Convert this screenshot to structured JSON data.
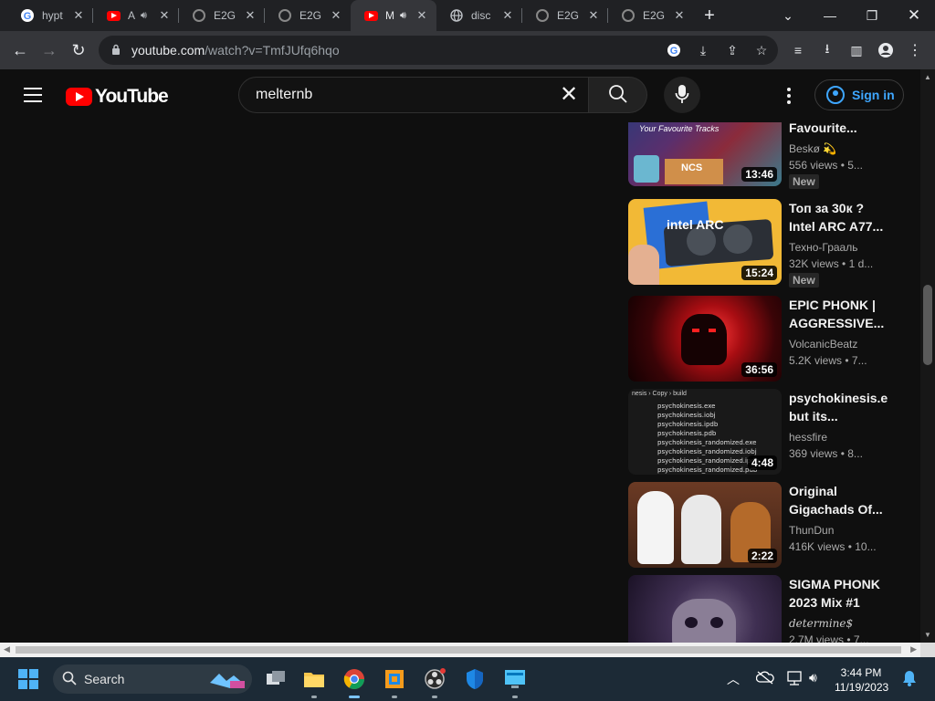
{
  "browser": {
    "tabs": [
      {
        "title": "hypt",
        "favicon": "google-icon",
        "active": false
      },
      {
        "title": "A",
        "favicon": "youtube-icon",
        "active": false,
        "audio": true
      },
      {
        "title": "E2G",
        "favicon": "github-icon",
        "active": false
      },
      {
        "title": "E2G",
        "favicon": "github-icon",
        "active": false
      },
      {
        "title": "M",
        "favicon": "youtube-icon",
        "active": true,
        "audio": true
      },
      {
        "title": "disc",
        "favicon": "globe-icon",
        "active": false
      },
      {
        "title": "E2G",
        "favicon": "github-icon",
        "active": false
      },
      {
        "title": "E2G",
        "favicon": "github-icon",
        "active": false
      }
    ],
    "url_host": "youtube.com",
    "url_path": "/watch?v=TmfJUfq6hqo"
  },
  "youtube": {
    "logo_text": "YouTube",
    "search_value": "melternb",
    "search_placeholder": "Search",
    "sign_in": "Sign in"
  },
  "videos": [
    {
      "title": "Favourite...",
      "thumb_text": "Your Favourite Tracks",
      "thumb_logo": "NCS",
      "channel": "Beskø 💫",
      "views": "556 views",
      "age": "5...",
      "duration": "13:46",
      "badge": "New"
    },
    {
      "title": "Топ за 30к ? Intel ARC A77...",
      "thumb_text": "intel ARC",
      "channel": "Техно-Грааль",
      "views": "32K views",
      "age": "1 d...",
      "duration": "15:24",
      "badge": "New"
    },
    {
      "title": "EPIC PHONK | AGGRESSIVE...",
      "channel": "VolcanicBeatz",
      "views": "5.2K views",
      "age": "7...",
      "duration": "36:56",
      "badge": ""
    },
    {
      "title": "psychokinesis.e but its...",
      "channel": "hessfire",
      "views": "369 views",
      "age": "8...",
      "duration": "4:48",
      "badge": "",
      "thumb_breadcrumb": "nesis › Copy › build",
      "thumb_files": [
        "psychokinesis.exe",
        "psychokinesis.iobj",
        "psychokinesis.ipdb",
        "psychokinesis.pdb",
        "psychokinesis_randomized.exe",
        "psychokinesis_randomized.iobj",
        "psychokinesis_randomized.ipdb",
        "psychokinesis_randomized.pdb"
      ]
    },
    {
      "title": "Original Gigachads Of...",
      "channel": "ThunDun",
      "views": "416K views",
      "age": "10...",
      "duration": "2:22",
      "badge": ""
    },
    {
      "title": "SIGMA PHONK 2023 Mix #1",
      "channel": "determine$",
      "views": "2.7M views",
      "age": "7...",
      "duration": "",
      "badge": ""
    }
  ],
  "taskbar": {
    "search_label": "Search",
    "time": "3:44 PM",
    "date": "11/19/2023"
  },
  "colors": {
    "accent": "#3ea6ff",
    "youtube_red": "#ff0000",
    "background": "#0f0f0f"
  }
}
